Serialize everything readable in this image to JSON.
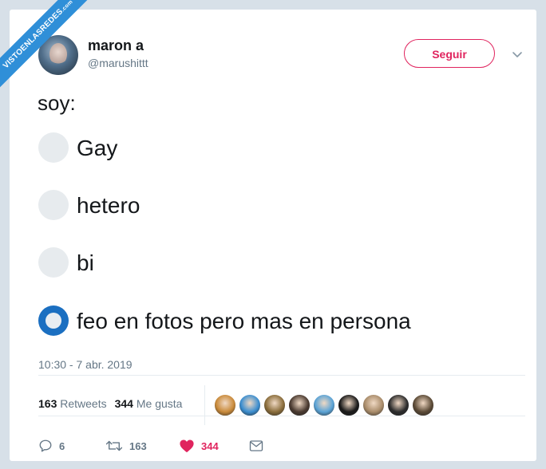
{
  "watermark": {
    "text": "VISTOENLASREDES",
    "suffix": ".com"
  },
  "author": {
    "name": "maron a",
    "handle": "@marushittt"
  },
  "follow_label": "Seguir",
  "tweet": {
    "text": "soy:"
  },
  "poll": {
    "options": [
      {
        "label": "Gay",
        "selected": false
      },
      {
        "label": "hetero",
        "selected": false
      },
      {
        "label": "bi",
        "selected": false
      },
      {
        "label": "feo en fotos pero mas en persona",
        "selected": true
      }
    ]
  },
  "timestamp": "10:30 - 7 abr. 2019",
  "stats": {
    "retweets_count": "163",
    "retweets_label": "Retweets",
    "likes_count": "344",
    "likes_label": "Me gusta"
  },
  "likers": [
    {
      "color": "#c98a3a"
    },
    {
      "color": "#3b8ed0"
    },
    {
      "color": "#8a6d3b"
    },
    {
      "color": "#4a3a30"
    },
    {
      "color": "#5aa3d6"
    },
    {
      "color": "#1a1a1a"
    },
    {
      "color": "#a98c6a"
    },
    {
      "color": "#2c2c2c"
    },
    {
      "color": "#5b4a36"
    }
  ],
  "actions": {
    "replies": "6",
    "retweets": "163",
    "likes": "344"
  },
  "colors": {
    "accent_pink": "#e0245e",
    "radio_selected": "#1b6fc1",
    "muted_text": "#657786"
  }
}
